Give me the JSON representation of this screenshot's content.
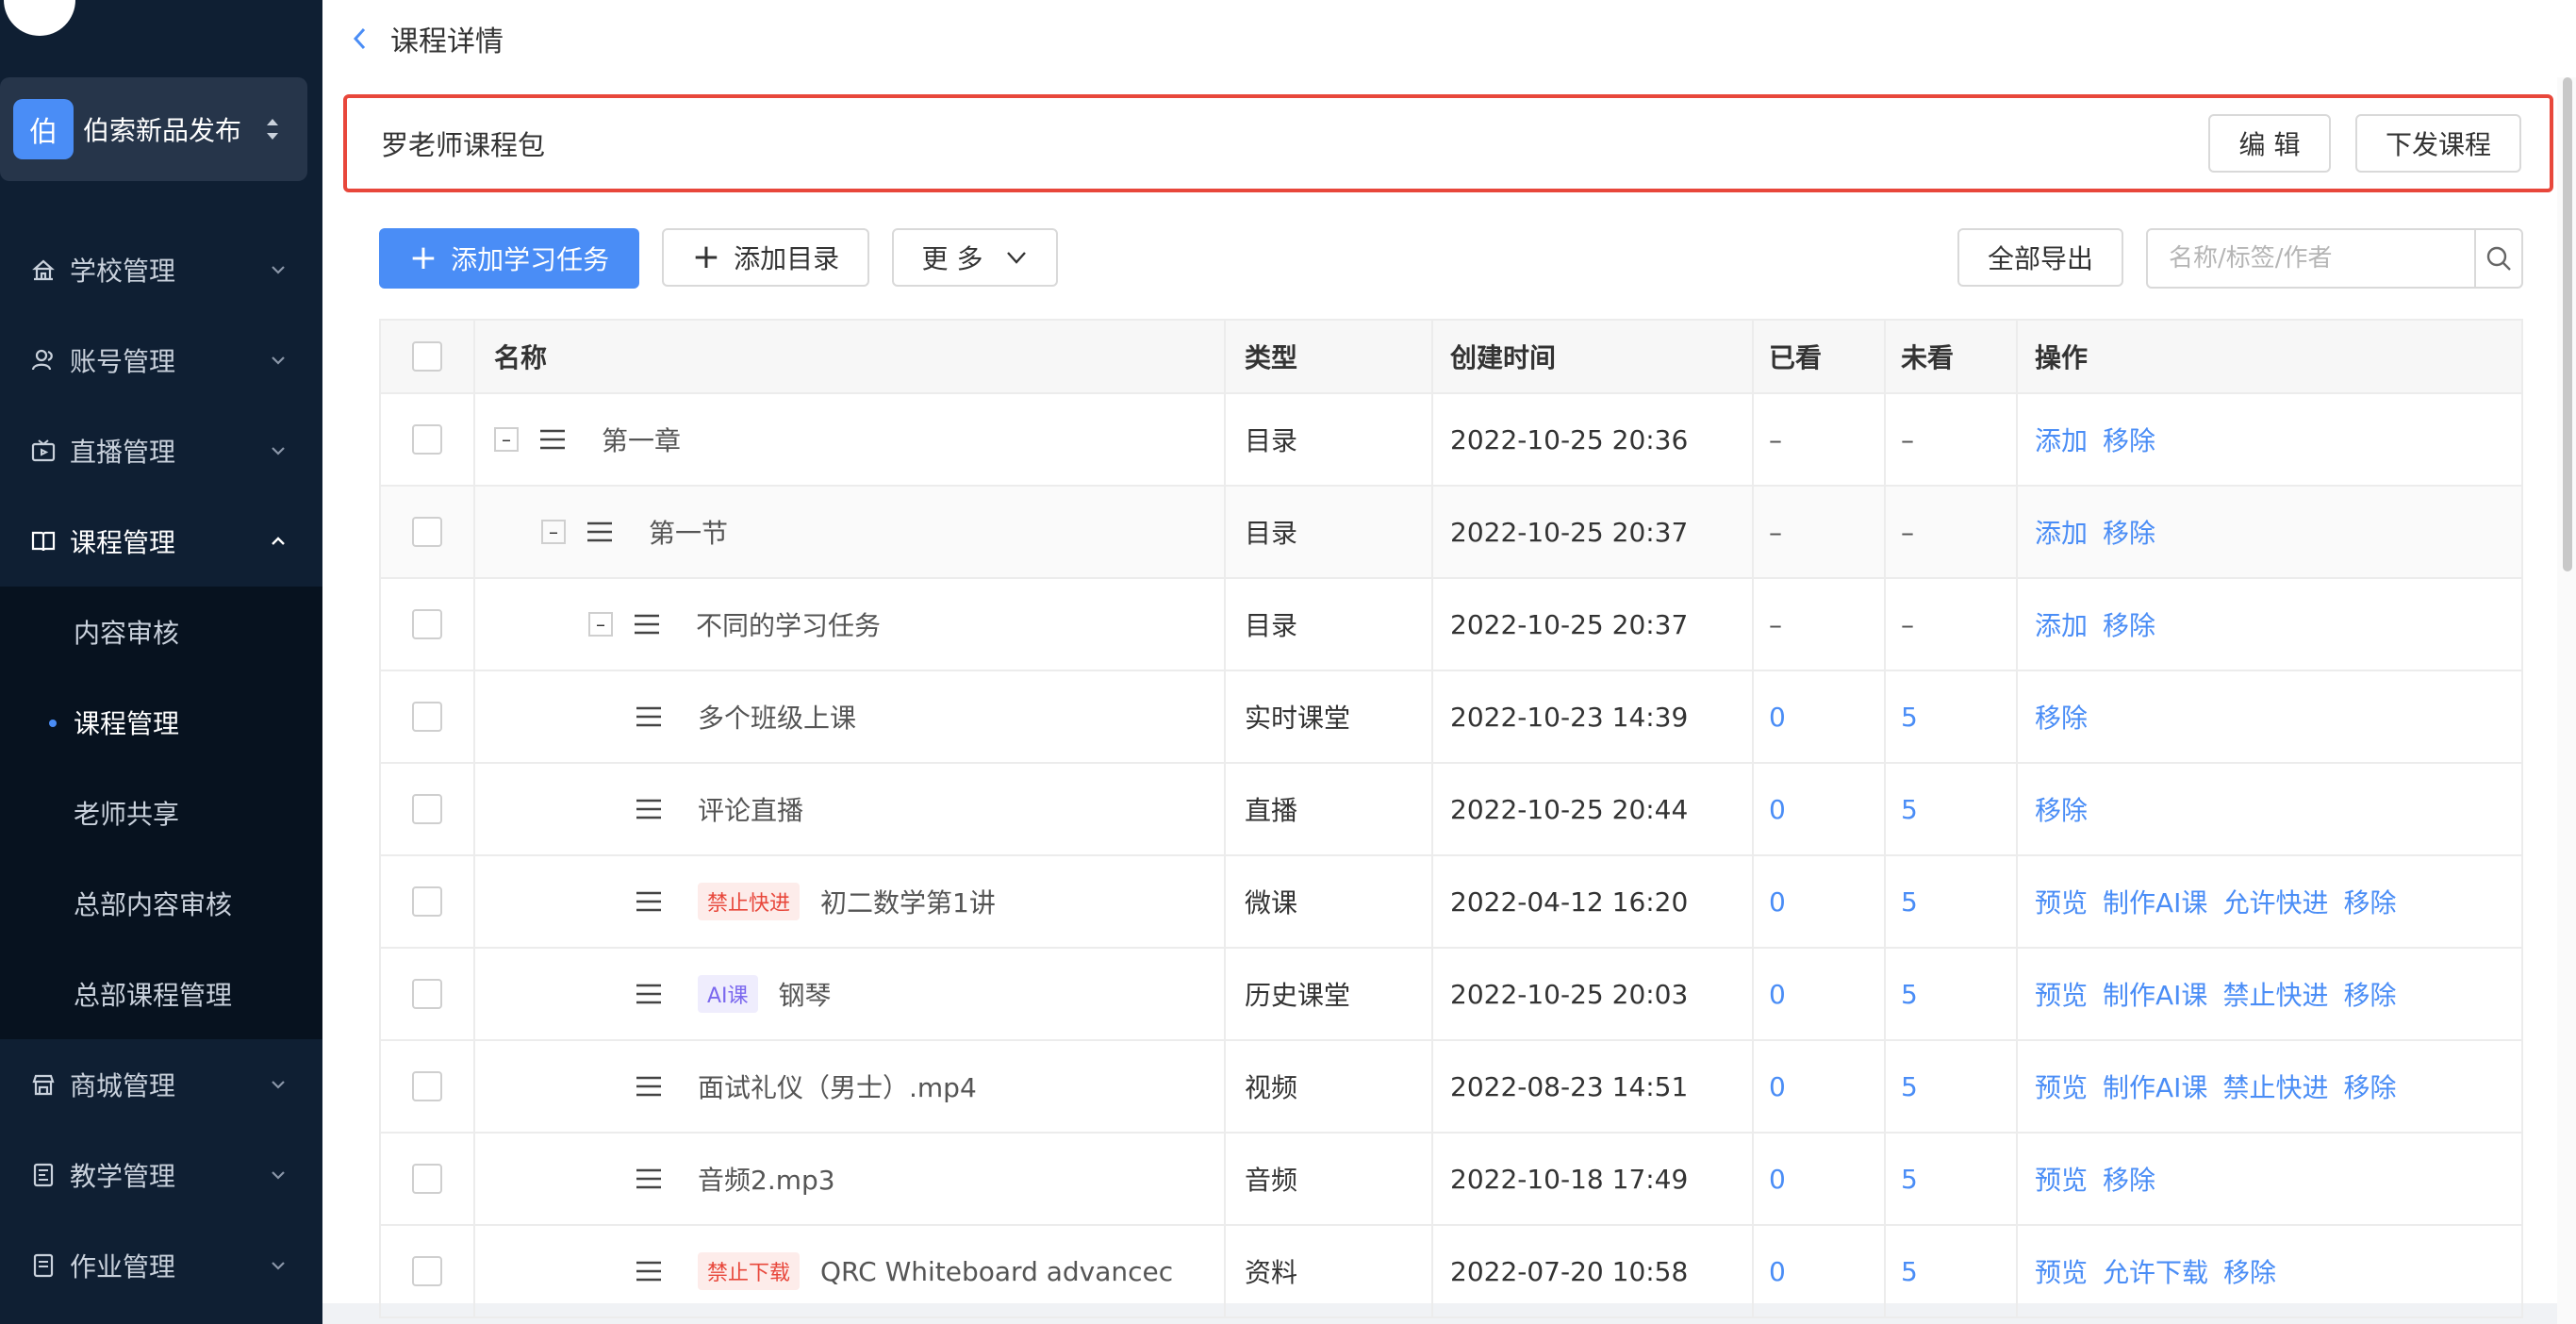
{
  "sidebar": {
    "org": {
      "avatar": "伯",
      "name": "伯索新品发布"
    },
    "menu": [
      {
        "label": "学校管理",
        "icon": "school-icon"
      },
      {
        "label": "账号管理",
        "icon": "user-icon"
      },
      {
        "label": "直播管理",
        "icon": "live-icon"
      },
      {
        "label": "课程管理",
        "icon": "course-icon"
      },
      {
        "label": "商城管理",
        "icon": "shop-icon"
      },
      {
        "label": "教学管理",
        "icon": "teaching-icon"
      },
      {
        "label": "作业管理",
        "icon": "homework-icon"
      }
    ],
    "submenu": [
      "内容审核",
      "课程管理",
      "老师共享",
      "总部内容审核",
      "总部课程管理"
    ]
  },
  "topbar": {
    "title": "课程详情"
  },
  "package": {
    "name": "罗老师课程包",
    "edit_label": "编 辑",
    "publish_label": "下发课程"
  },
  "toolbar": {
    "add_task": "添加学习任务",
    "add_dir": "添加目录",
    "more": "更 多",
    "export": "全部导出",
    "search_placeholder": "名称/标签/作者"
  },
  "table": {
    "headers": {
      "name": "名称",
      "type": "类型",
      "time": "创建时间",
      "seen": "已看",
      "unseen": "未看",
      "ops": "操作"
    },
    "rows": [
      {
        "name": "第一章",
        "tag": "",
        "type": "目录",
        "time": "2022-10-25 20:36",
        "seen": "–",
        "unseen": "–",
        "ops": [
          "添加",
          "移除"
        ]
      },
      {
        "name": "第一节",
        "tag": "",
        "type": "目录",
        "time": "2022-10-25 20:37",
        "seen": "–",
        "unseen": "–",
        "ops": [
          "添加",
          "移除"
        ]
      },
      {
        "name": "不同的学习任务",
        "tag": "",
        "type": "目录",
        "time": "2022-10-25 20:37",
        "seen": "–",
        "unseen": "–",
        "ops": [
          "添加",
          "移除"
        ]
      },
      {
        "name": "多个班级上课",
        "tag": "",
        "type": "实时课堂",
        "time": "2022-10-23 14:39",
        "seen": "0",
        "unseen": "5",
        "ops": [
          "移除"
        ]
      },
      {
        "name": "评论直播",
        "tag": "",
        "type": "直播",
        "time": "2022-10-25 20:44",
        "seen": "0",
        "unseen": "5",
        "ops": [
          "移除"
        ]
      },
      {
        "name": "初二数学第1讲",
        "tag": "禁止快进",
        "type": "微课",
        "time": "2022-04-12 16:20",
        "seen": "0",
        "unseen": "5",
        "ops": [
          "预览",
          "制作AI课",
          "允许快进",
          "移除"
        ]
      },
      {
        "name": "钢琴",
        "tag": "AI课",
        "type": "历史课堂",
        "time": "2022-10-25 20:03",
        "seen": "0",
        "unseen": "5",
        "ops": [
          "预览",
          "制作AI课",
          "禁止快进",
          "移除"
        ]
      },
      {
        "name": "面试礼仪（男士）.mp4",
        "tag": "",
        "type": "视频",
        "time": "2022-08-23 14:51",
        "seen": "0",
        "unseen": "5",
        "ops": [
          "预览",
          "制作AI课",
          "禁止快进",
          "移除"
        ]
      },
      {
        "name": "音频2.mp3",
        "tag": "",
        "type": "音频",
        "time": "2022-10-18 17:49",
        "seen": "0",
        "unseen": "5",
        "ops": [
          "预览",
          "移除"
        ]
      },
      {
        "name": "QRC Whiteboard advancec",
        "tag": "禁止下载",
        "type": "资料",
        "time": "2022-07-20 10:58",
        "seen": "0",
        "unseen": "5",
        "ops": [
          "预览",
          "允许下载",
          "移除"
        ]
      }
    ]
  },
  "colors": {
    "accent": "#4a8df6",
    "sidebar_bg": "#0f1f33",
    "highlight_border": "#e8473b"
  }
}
